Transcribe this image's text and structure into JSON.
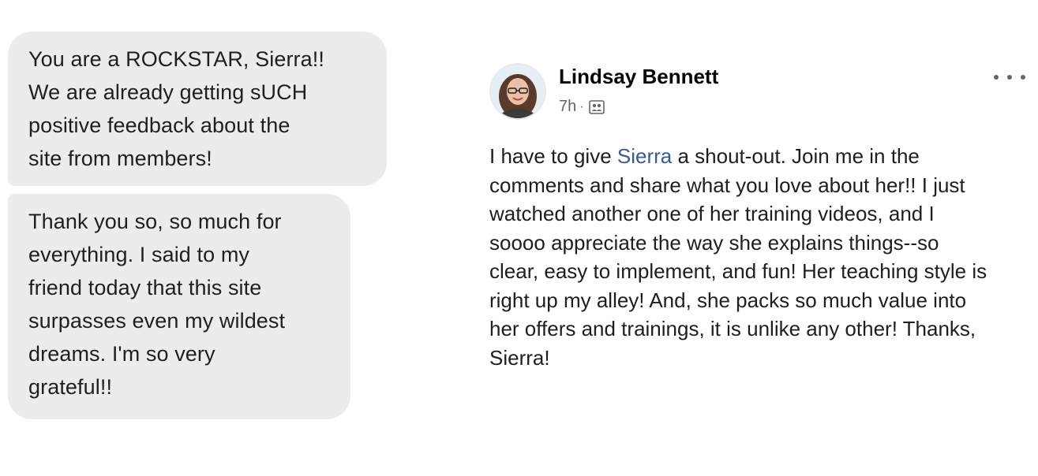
{
  "messages": [
    {
      "lines": [
        "You are a ROCKSTAR, Sierra!!",
        "We are already getting sUCH",
        "positive feedback about the",
        "site from members!"
      ]
    },
    {
      "lines": [
        "Thank you so, so much for",
        "everything. I said to my",
        "friend today that this site",
        "surpasses even my wildest",
        "dreams. I'm so very",
        "grateful!!"
      ]
    }
  ],
  "post": {
    "author": "Lindsay Bennett",
    "time": "7h",
    "separator": "·",
    "audience_icon": "friends-audience-icon",
    "more_icon": "more-options-icon",
    "text": {
      "line1_before": "I have to give ",
      "mention": "Sierra",
      "line1_after": " a shout-out. Join me in the",
      "line2": "comments and share what you love about her!! I just",
      "line3": "watched another one of her training videos, and I",
      "line4": "soooo appreciate the way she explains things--so",
      "line5": "clear, easy to implement, and fun! Her teaching style is",
      "line6": "right up my alley! And, she packs so much value into",
      "line7": "her offers and trainings, it is unlike any other! Thanks,",
      "line8": "Sierra!"
    }
  },
  "colors": {
    "bubble_bg": "#ececec",
    "mention": "#385898",
    "meta_text": "#65676b"
  }
}
